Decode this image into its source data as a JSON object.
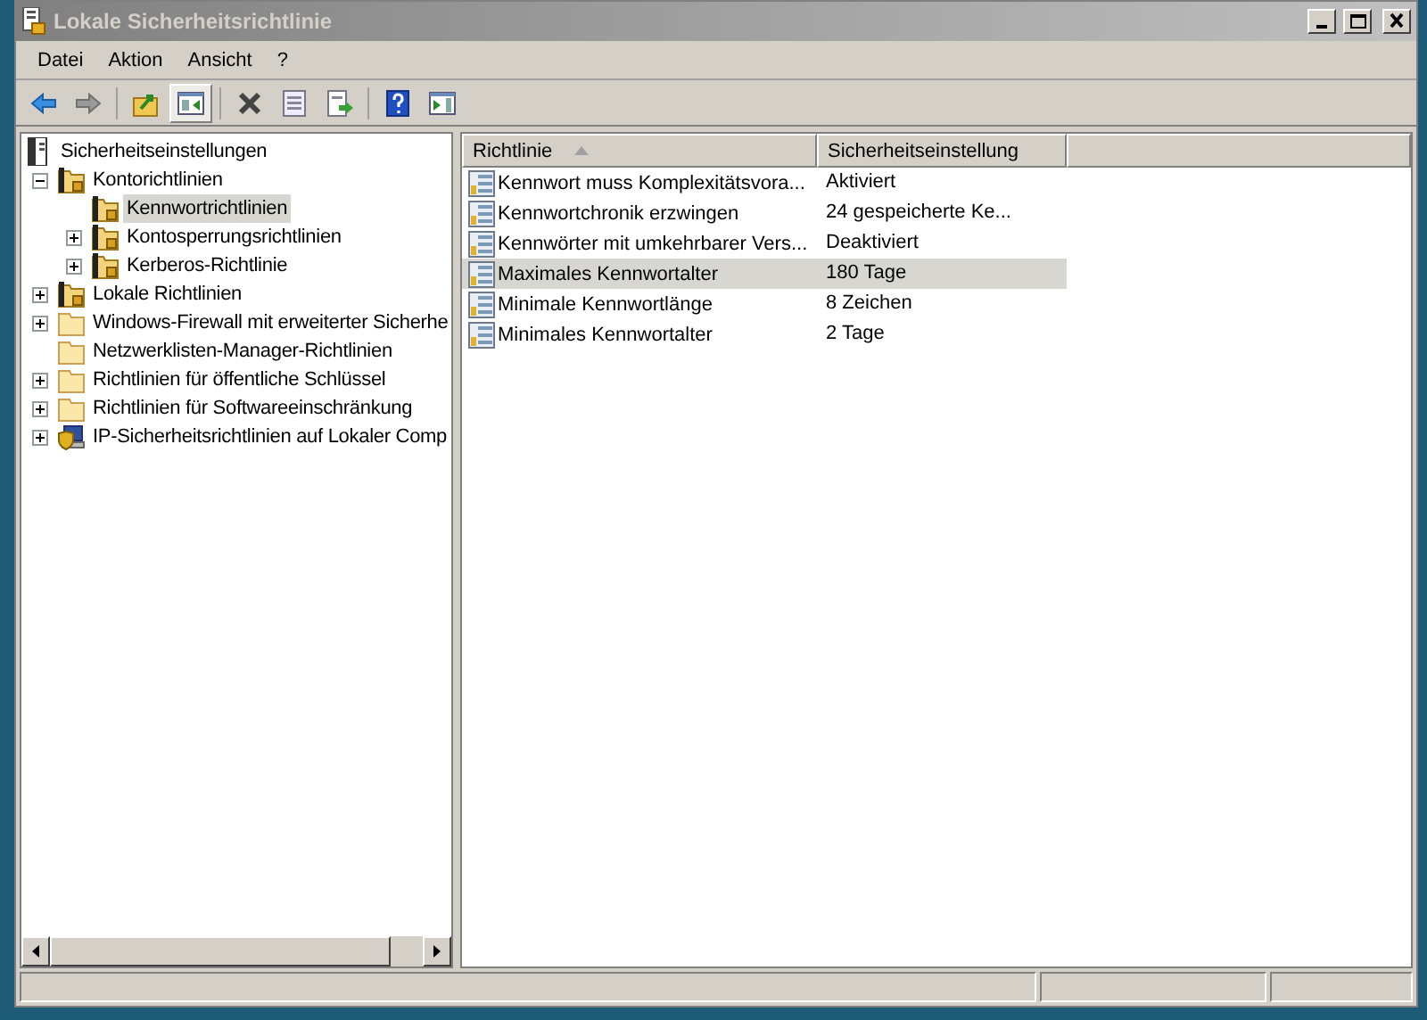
{
  "window": {
    "title": "Lokale Sicherheitsrichtlinie",
    "active": false
  },
  "menu": [
    {
      "label": "Datei"
    },
    {
      "label": "Aktion"
    },
    {
      "label": "Ansicht"
    },
    {
      "label": "?"
    }
  ],
  "toolbar_groups": [
    {
      "buttons": [
        {
          "kind": "back",
          "pressed": false
        },
        {
          "kind": "forward",
          "pressed": false
        }
      ]
    },
    {
      "buttons": [
        {
          "kind": "up",
          "pressed": false
        },
        {
          "kind": "tree",
          "pressed": true
        }
      ]
    },
    {
      "buttons": [
        {
          "kind": "delete",
          "pressed": false
        },
        {
          "kind": "properties",
          "pressed": false
        },
        {
          "kind": "export",
          "pressed": false
        }
      ]
    },
    {
      "buttons": [
        {
          "kind": "help",
          "pressed": false
        },
        {
          "kind": "actionpane",
          "pressed": false
        }
      ]
    }
  ],
  "tree": [
    {
      "label": "Sicherheitseinstellungen",
      "kind": "root",
      "selected": false,
      "children": [
        {
          "label": "Kontorichtlinien",
          "kind": "policy",
          "expanded": true,
          "selected": false,
          "children": [
            {
              "label": "Kennwortrichtlinien",
              "kind": "policy",
              "selected": true
            },
            {
              "label": "Kontosperrungsrichtlinien",
              "kind": "policy",
              "expanded": false,
              "selected": false
            },
            {
              "label": "Kerberos-Richtlinie",
              "kind": "policy",
              "expanded": false,
              "selected": false
            }
          ]
        },
        {
          "label": "Lokale Richtlinien",
          "kind": "policy",
          "expanded": false,
          "selected": false
        },
        {
          "label": "Windows-Firewall mit erweiterter Sicherhe",
          "kind": "folder",
          "expanded": false,
          "selected": false
        },
        {
          "label": "Netzwerklisten-Manager-Richtlinien",
          "kind": "folder",
          "selected": false
        },
        {
          "label": "Richtlinien für öffentliche Schlüssel",
          "kind": "folder",
          "expanded": false,
          "selected": false
        },
        {
          "label": "Richtlinien für Softwareeinschränkung",
          "kind": "folder",
          "expanded": false,
          "selected": false
        },
        {
          "label": "IP-Sicherheitsrichtlinien auf Lokaler Comp",
          "kind": "ipsec",
          "expanded": false,
          "selected": false
        }
      ]
    }
  ],
  "table": {
    "columns": [
      {
        "label": "Richtlinie",
        "sorted": true
      },
      {
        "label": "Sicherheitseinstellung",
        "sorted": false
      }
    ],
    "rows": [
      {
        "policy": "Kennwort muss Komplexitätsvora...",
        "setting": "Aktiviert",
        "selected": false
      },
      {
        "policy": "Kennwortchronik erzwingen",
        "setting": "24 gespeicherte Ke...",
        "selected": false
      },
      {
        "policy": "Kennwörter mit umkehrbarer Vers...",
        "setting": "Deaktiviert",
        "selected": false
      },
      {
        "policy": "Maximales Kennwortalter",
        "setting": "180 Tage",
        "selected": true
      },
      {
        "policy": "Minimale Kennwortlänge",
        "setting": "8 Zeichen",
        "selected": false
      },
      {
        "policy": "Minimales Kennwortalter",
        "setting": "2 Tage",
        "selected": false
      }
    ]
  }
}
